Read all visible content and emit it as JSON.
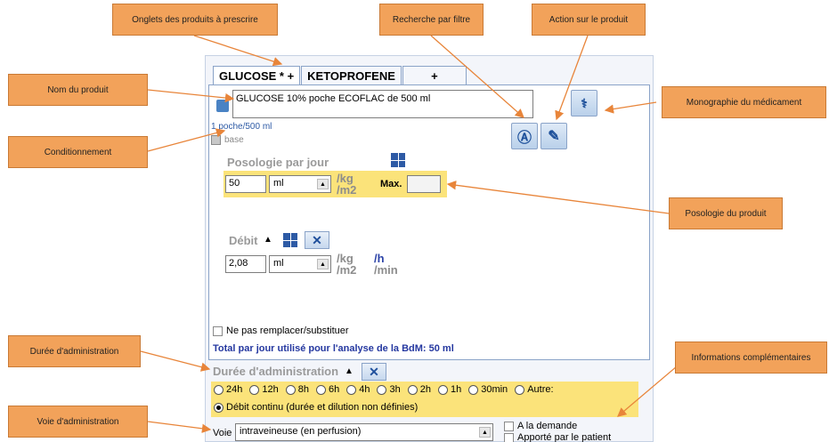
{
  "callouts": {
    "onglets": "Onglets des produits à prescrire",
    "recherche": "Recherche par filtre",
    "action": "Action sur le produit",
    "nom": "Nom du produit",
    "monographie": "Monographie du médicament",
    "conditionnement": "Conditionnement",
    "posologie": "Posologie du produit",
    "duree": "Durée d'administration",
    "infos": "Informations complémentaires",
    "voie": "Voie d'administration"
  },
  "tabs": [
    {
      "label": "GLUCOSE * +"
    },
    {
      "label": "KETOPROFENE"
    },
    {
      "label": "+"
    }
  ],
  "product": {
    "name": "GLUCOSE 10% poche ECOFLAC de 500 ml",
    "conditionnement": "1 poche/500 ml",
    "base_label": "base"
  },
  "posologie": {
    "title": "Posologie par jour",
    "value": "50",
    "unit": "ml",
    "per_kg": "/kg",
    "per_m2": "/m2",
    "max_label": "Max.",
    "max_value": ""
  },
  "debit": {
    "title": "Débit",
    "sort": "▲",
    "value": "2,08",
    "unit": "ml",
    "per_kg": "/kg",
    "per_m2": "/m2",
    "per_h": "/h",
    "per_min": "/min"
  },
  "substitution_label": "Ne pas remplacer/substituer",
  "total_text": "Total par jour utilisé pour l'analyse de la BdM: 50 ml",
  "duree": {
    "title": "Durée d'administration",
    "sort": "▲",
    "options": [
      "24h",
      "12h",
      "8h",
      "6h",
      "4h",
      "3h",
      "2h",
      "1h",
      "30min",
      "Autre:"
    ],
    "continu_label": "Débit continu (durée et dilution non définies)"
  },
  "voie": {
    "label": "Voie",
    "value": "intraveineuse (en perfusion)",
    "a_la_demande": "A la demande",
    "apporte": "Apporté par le patient"
  },
  "colors": {
    "callout": "#f2a25a",
    "highlight": "#fbe37a",
    "blue_text": "#2538a0"
  }
}
